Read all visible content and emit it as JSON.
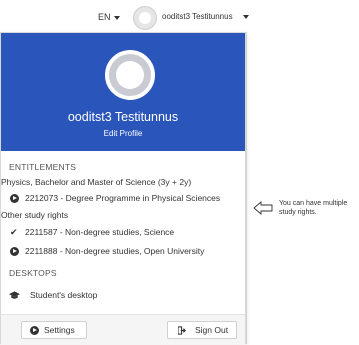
{
  "topbar": {
    "language": "EN",
    "username": "ooditst3 Testitunnus"
  },
  "page_left_fragments": [
    "u",
    "t",
    "n",
    "a",
    "a",
    "o",
    "L",
    "u",
    "a",
    "e",
    "s"
  ],
  "profile": {
    "name": "ooditst3 Testitunnus",
    "edit_label": "Edit Profile"
  },
  "entitlements": {
    "heading": "ENTITLEMENTS",
    "primary_group": "Physics, Bachelor and Master of Science (3y + 2y)",
    "primary_items": [
      {
        "icon": "circle-arrow-right-icon",
        "label": "2212073 - Degree Programme in Physical Sciences"
      }
    ],
    "other_group": "Other study rights",
    "other_items": [
      {
        "icon": "check-icon",
        "label": "2211587 - Non-degree studies, Science"
      },
      {
        "icon": "circle-arrow-right-icon",
        "label": "2211888 - Non-degree studies, Open University"
      }
    ]
  },
  "desktops": {
    "heading": "DESKTOPS",
    "items": [
      {
        "icon": "graduation-cap-icon",
        "label": "Student's desktop"
      }
    ]
  },
  "footer": {
    "settings_label": "Settings",
    "signout_label": "Sign Out"
  },
  "annotation": {
    "text": "You can have multiple study rights."
  }
}
